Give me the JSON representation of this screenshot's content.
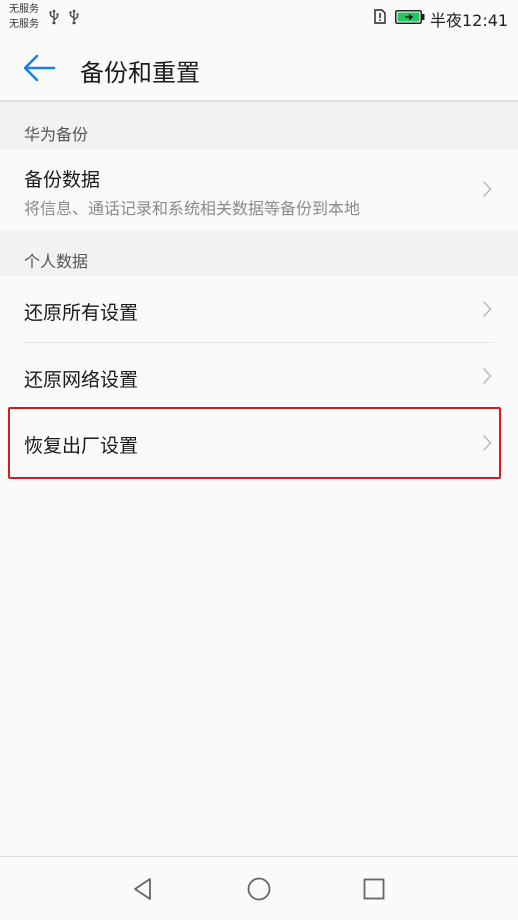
{
  "status_bar": {
    "carrier_1": "无服务",
    "carrier_2": "无服务",
    "time": "半夜12:41",
    "battery_color": "#22c55e"
  },
  "header": {
    "title": "备份和重置",
    "accent_color": "#1a82e2"
  },
  "sections": [
    {
      "header": "华为备份",
      "items": [
        {
          "title": "备份数据",
          "subtitle": "将信息、通话记录和系统相关数据等备份到本地"
        }
      ]
    },
    {
      "header": "个人数据",
      "items": [
        {
          "title": "还原所有设置"
        },
        {
          "title": "还原网络设置"
        },
        {
          "title": "恢复出厂设置"
        }
      ]
    }
  ],
  "highlight_color": "#d71920",
  "icons": {
    "usb": "usb-icon",
    "sim_alert": "sim-alert-icon",
    "battery": "battery-charging-icon",
    "back": "arrow-left-icon",
    "chevron": "chevron-right-icon",
    "nav_back": "triangle-back-icon",
    "nav_home": "circle-home-icon",
    "nav_recent": "square-recent-icon"
  }
}
